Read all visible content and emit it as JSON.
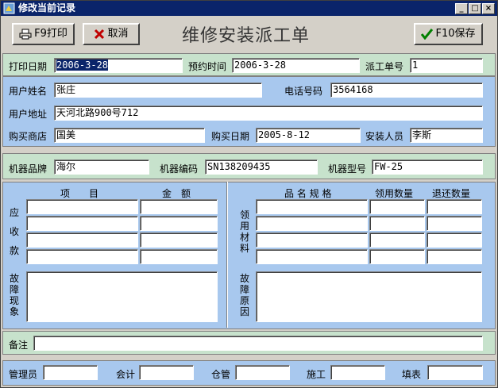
{
  "window": {
    "title": "修改当前记录",
    "min": "_",
    "max": "□",
    "close": "×"
  },
  "toolbar": {
    "print_label": "F9打印",
    "cancel_label": "取消",
    "save_label": "F10保存",
    "heading": "维修安装派工单"
  },
  "row1": {
    "print_date_label": "打印日期",
    "print_date_value": "2006-3-28",
    "appointment_label": "预约时间",
    "appointment_value": "2006-3-28",
    "order_no_label": "派工单号",
    "order_no_value": "1"
  },
  "customer": {
    "name_label": "用户姓名",
    "name_value": "张庄",
    "phone_label": "电话号码",
    "phone_value": "3564168",
    "address_label": "用户地址",
    "address_value": "天河北路900号712",
    "store_label": "购买商店",
    "store_value": "国美",
    "buy_date_label": "购买日期",
    "buy_date_value": "2005-8-12",
    "installer_label": "安装人员",
    "installer_value": "李斯"
  },
  "machine": {
    "brand_label": "机器品牌",
    "brand_value": "海尔",
    "code_label": "机器编码",
    "code_value": "SN138209435",
    "model_label": "机器型号",
    "model_value": "FW-25"
  },
  "charges": {
    "col_item": "项　　目",
    "col_amount": "金　额",
    "side_label": "应收款",
    "fault_label": "故障现象"
  },
  "materials": {
    "col_spec": "品 名 规 格",
    "col_used": "领用数量",
    "col_returned": "退还数量",
    "side_label": "领用材料",
    "cause_label": "故障原因"
  },
  "remark": {
    "label": "备注"
  },
  "signatures": {
    "manager": "管理员",
    "accountant": "会计",
    "warehouse": "仓管",
    "construction": "施工",
    "filler": "填表"
  }
}
